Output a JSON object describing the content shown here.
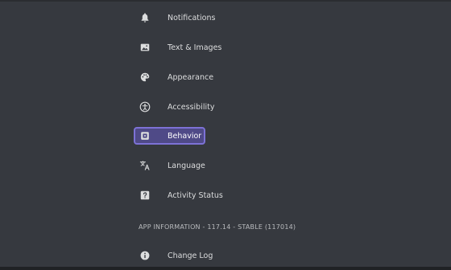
{
  "settings_menu": {
    "items": [
      {
        "label": "Notifications",
        "icon": "bell-icon"
      },
      {
        "label": "Text & Images",
        "icon": "image-icon"
      },
      {
        "label": "Appearance",
        "icon": "palette-icon"
      },
      {
        "label": "Accessibility",
        "icon": "accessibility-icon"
      },
      {
        "label": "Behavior",
        "icon": "behavior-icon",
        "selected": true
      },
      {
        "label": "Language",
        "icon": "translate-icon"
      },
      {
        "label": "Activity Status",
        "icon": "activity-status-icon"
      }
    ],
    "section_header": "APP INFORMATION - 117.14 - STABLE (117014)",
    "info_items": [
      {
        "label": "Change Log",
        "icon": "info-icon"
      }
    ]
  },
  "colors": {
    "background": "#36393f",
    "selected_background": "#4f4a87",
    "selected_border": "#7d72d6",
    "text": "#dcddde"
  }
}
